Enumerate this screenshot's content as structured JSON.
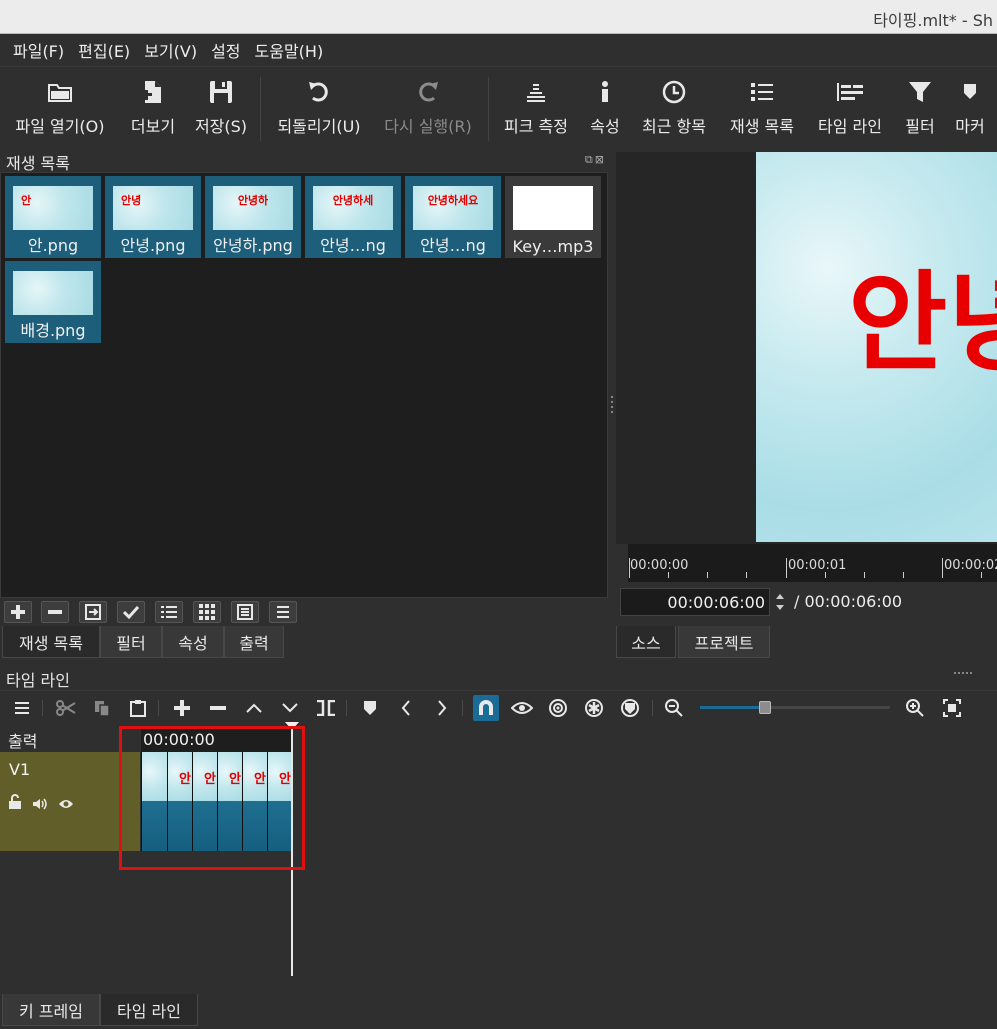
{
  "window": {
    "title": "타이핑.mlt* - Sh"
  },
  "menu": [
    {
      "id": "file",
      "label": "파일(F)"
    },
    {
      "id": "edit",
      "label": "편집(E)"
    },
    {
      "id": "view",
      "label": "보기(V)"
    },
    {
      "id": "settings",
      "label": "설정"
    },
    {
      "id": "help",
      "label": "도움말(H)"
    }
  ],
  "toolbar": {
    "open": "파일 열기(O)",
    "more": "더보기",
    "save": "저장(S)",
    "undo": "되돌리기(U)",
    "redo": "다시 실행(R)",
    "peak": "피크 측정",
    "properties": "속성",
    "recent": "최근 항목",
    "playlist": "재생 목록",
    "timeline": "타임 라인",
    "filters": "필터",
    "markers": "마커"
  },
  "playlist": {
    "title": "재생 목록",
    "items": [
      {
        "caption": "안.png",
        "thumb_text": "안"
      },
      {
        "caption": "안녕.png",
        "thumb_text": "안녕"
      },
      {
        "caption": "안녕하.png",
        "thumb_text": "안녕하"
      },
      {
        "caption": "안녕…ng",
        "thumb_text": "안녕하세"
      },
      {
        "caption": "안녕…ng",
        "thumb_text": "안녕하세요"
      },
      {
        "caption": "Key…mp3",
        "thumb_text": ""
      },
      {
        "caption": "배경.png",
        "thumb_text": ""
      }
    ]
  },
  "panel_tabs": [
    {
      "id": "playlist",
      "label": "재생 목록"
    },
    {
      "id": "filters",
      "label": "필터"
    },
    {
      "id": "properties",
      "label": "속성"
    },
    {
      "id": "export",
      "label": "출력"
    }
  ],
  "viewer": {
    "preview_text": "안녕",
    "ruler": [
      "00:00:00",
      "00:00:01",
      "00:00:02"
    ],
    "timecode": "00:00:06:00",
    "duration": "/ 00:00:06:00",
    "tabs": [
      {
        "id": "source",
        "label": "소스"
      },
      {
        "id": "project",
        "label": "프로젝트"
      }
    ]
  },
  "timeline": {
    "title": "타임 라인",
    "output_label": "출력",
    "track_name": "V1",
    "ruler_time": "00:00:00",
    "clip_text": "안",
    "zoom_level": 0.34
  },
  "bottom_tabs": [
    {
      "id": "keyframes",
      "label": "키 프레임"
    },
    {
      "id": "timeline",
      "label": "타임 라인"
    }
  ],
  "colors": {
    "accent": "#1a6b96",
    "track_header": "#625e2a",
    "highlight_box": "#e01010",
    "preview_text": "#e80000"
  }
}
